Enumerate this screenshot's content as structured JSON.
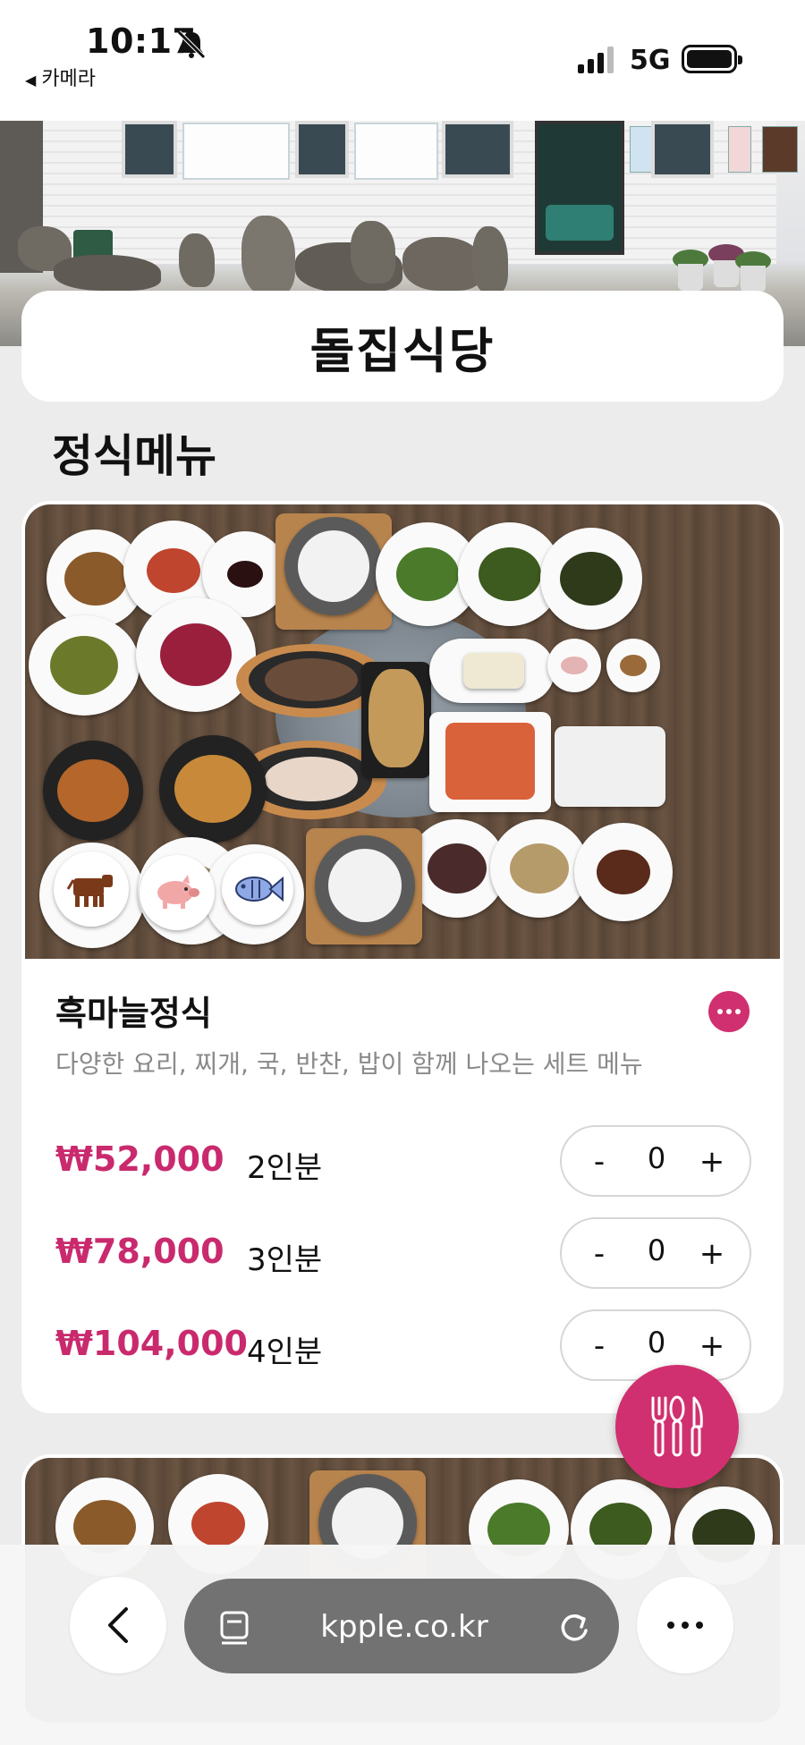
{
  "status_bar": {
    "time": "10:17",
    "back_app": "카메라",
    "network": "5G"
  },
  "restaurant": {
    "name": "돌집식당"
  },
  "section": {
    "title": "정식메뉴"
  },
  "menu_item": {
    "name": "흑마늘정식",
    "description": "다양한 요리, 찌개, 국, 반찬, 밥이 함께 나오는 세트 메뉴",
    "options": [
      {
        "price": "₩52,000",
        "serving": "2인분",
        "minus": "-",
        "qty": "0",
        "plus": "+"
      },
      {
        "price": "₩78,000",
        "serving": "3인분",
        "minus": "-",
        "qty": "0",
        "plus": "+"
      },
      {
        "price": "₩104,000",
        "serving": "4인분",
        "minus": "-",
        "qty": "0",
        "plus": "+"
      }
    ]
  },
  "browser": {
    "url": "kpple.co.kr"
  },
  "colors": {
    "accent": "#d0306f",
    "price": "#c92a6d",
    "url_pill": "#727272"
  },
  "icons": {
    "fab": "utensils-icon",
    "menu_item_more": "more-dots-icon",
    "meat_types": [
      "cow-icon",
      "pig-icon",
      "fish-icon"
    ]
  }
}
